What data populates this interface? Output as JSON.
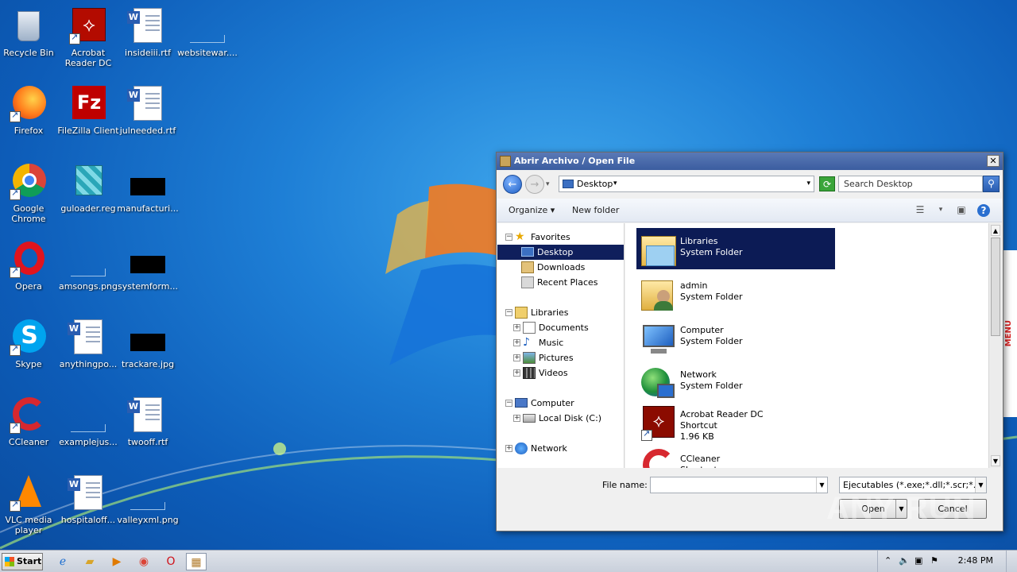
{
  "desktop": {
    "icons": [
      {
        "label": "Recycle Bin",
        "icon": "recycle-bin-icon"
      },
      {
        "label": "Acrobat Reader DC",
        "icon": "acrobat-icon"
      },
      {
        "label": "insideiii.rtf",
        "icon": "word-doc-icon"
      },
      {
        "label": "websitewar....",
        "icon": "image-file-icon"
      },
      {
        "label": "Firefox",
        "icon": "firefox-icon"
      },
      {
        "label": "FileZilla Client",
        "icon": "filezilla-icon"
      },
      {
        "label": "julneeded.rtf",
        "icon": "word-doc-icon"
      },
      {
        "label": "Google Chrome",
        "icon": "chrome-icon"
      },
      {
        "label": "guloader.reg",
        "icon": "registry-icon"
      },
      {
        "label": "manufacturi...",
        "icon": "black-file-icon"
      },
      {
        "label": "Opera",
        "icon": "opera-icon"
      },
      {
        "label": "amsongs.png",
        "icon": "image-file-icon"
      },
      {
        "label": "systemform...",
        "icon": "black-file-icon"
      },
      {
        "label": "Skype",
        "icon": "skype-icon"
      },
      {
        "label": "anythingpo...",
        "icon": "word-doc-icon"
      },
      {
        "label": "trackare.jpg",
        "icon": "black-file-icon"
      },
      {
        "label": "CCleaner",
        "icon": "ccleaner-icon"
      },
      {
        "label": "examplejus...",
        "icon": "image-file-icon"
      },
      {
        "label": "twooff.rtf",
        "icon": "word-doc-icon"
      },
      {
        "label": "VLC media player",
        "icon": "vlc-icon"
      },
      {
        "label": "hospitaloff...",
        "icon": "word-doc-icon"
      },
      {
        "label": "valleyxml.png",
        "icon": "image-file-icon"
      }
    ]
  },
  "dialog": {
    "title": "Abrir Archivo / Open File",
    "close": "✕",
    "address": "Desktop",
    "search_placeholder": "Search Desktop",
    "toolbar": {
      "organize": "Organize",
      "new_folder": "New folder"
    },
    "tree": {
      "favorites": "Favorites",
      "desktop": "Desktop",
      "downloads": "Downloads",
      "recent": "Recent Places",
      "libraries": "Libraries",
      "documents": "Documents",
      "music": "Music",
      "pictures": "Pictures",
      "videos": "Videos",
      "computer": "Computer",
      "local_disk": "Local Disk (C:)",
      "network": "Network"
    },
    "files": [
      {
        "name": "Libraries",
        "type": "System Folder",
        "size": ""
      },
      {
        "name": "admin",
        "type": "System Folder",
        "size": ""
      },
      {
        "name": "Computer",
        "type": "System Folder",
        "size": ""
      },
      {
        "name": "Network",
        "type": "System Folder",
        "size": ""
      },
      {
        "name": "Acrobat Reader DC",
        "type": "Shortcut",
        "size": "1.96 KB"
      },
      {
        "name": "CCleaner",
        "type": "Shortcut",
        "size": ""
      }
    ],
    "file_name_label": "File name:",
    "file_name_value": "",
    "filter": "Ejecutables (*.exe;*.dll;*.scr;*.cp",
    "open": "Open",
    "cancel": "Cancel"
  },
  "partial_window_text": "MENU",
  "watermark": "ANY RUN",
  "taskbar": {
    "start": "Start",
    "clock": "2:48 PM"
  },
  "colors": {
    "selection": "#0c1b55",
    "titlebar": "#4a6aab",
    "desktop": "#1e7fd6"
  }
}
